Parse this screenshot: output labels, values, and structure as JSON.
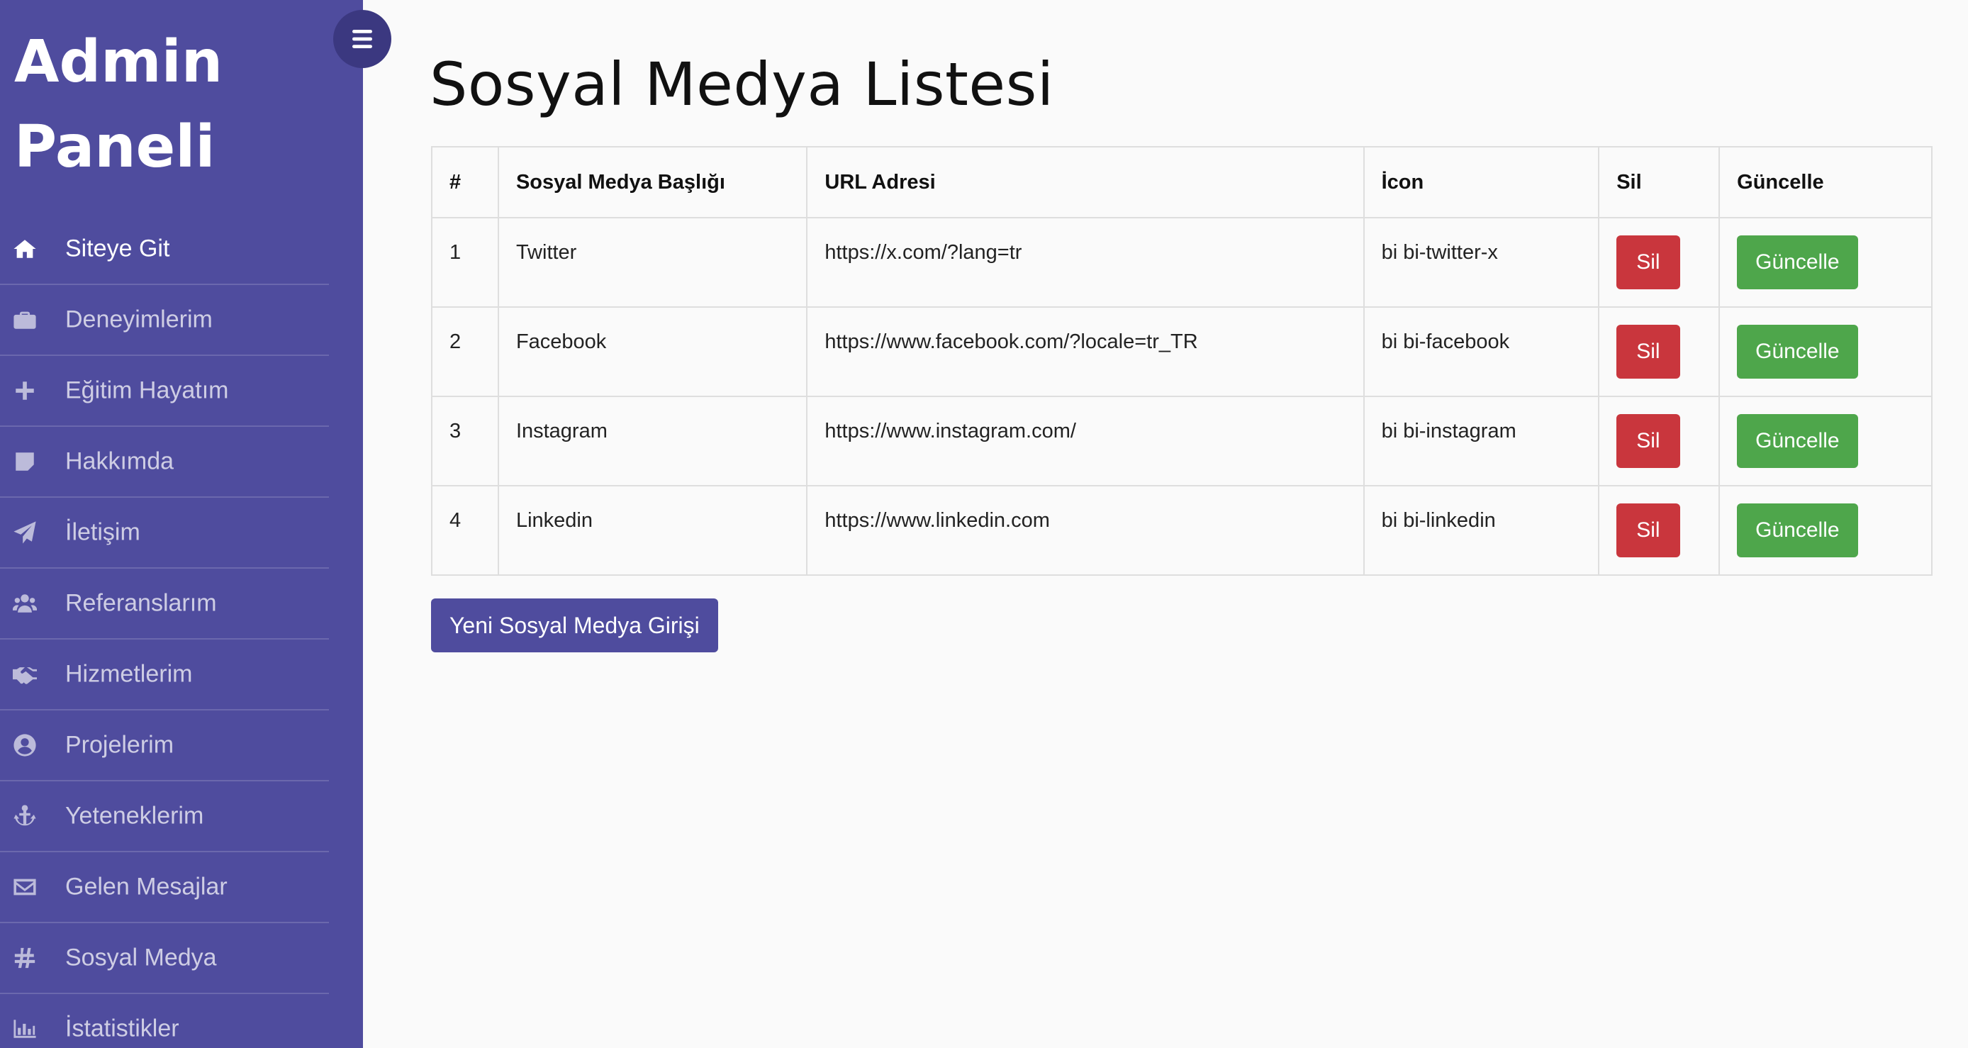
{
  "sidebar": {
    "brand": "Admin Paneli",
    "items": [
      {
        "label": "Siteye Git",
        "icon": "home-icon"
      },
      {
        "label": "Deneyimlerim",
        "icon": "briefcase-icon"
      },
      {
        "label": "Eğitim Hayatım",
        "icon": "plus-icon"
      },
      {
        "label": "Hakkımda",
        "icon": "note-icon"
      },
      {
        "label": "İletişim",
        "icon": "paper-plane-icon"
      },
      {
        "label": "Referanslarım",
        "icon": "users-icon"
      },
      {
        "label": "Hizmetlerim",
        "icon": "handshake-icon"
      },
      {
        "label": "Projelerim",
        "icon": "user-circle-icon"
      },
      {
        "label": "Yeteneklerim",
        "icon": "anchor-icon"
      },
      {
        "label": "Gelen Mesajlar",
        "icon": "envelope-icon"
      },
      {
        "label": "Sosyal Medya",
        "icon": "hashtag-icon"
      },
      {
        "label": "İstatistikler",
        "icon": "bar-chart-icon"
      }
    ]
  },
  "main": {
    "title": "Sosyal Medya Listesi",
    "table": {
      "headers": [
        "#",
        "Sosyal Medya Başlığı",
        "URL Adresi",
        "İcon",
        "Sil",
        "Güncelle"
      ],
      "rows": [
        {
          "num": "1",
          "title": "Twitter",
          "url": "https://x.com/?lang=tr",
          "icon": "bi bi-twitter-x",
          "sil": "Sil",
          "guncelle": "Güncelle"
        },
        {
          "num": "2",
          "title": "Facebook",
          "url": "https://www.facebook.com/?locale=tr_TR",
          "icon": "bi bi-facebook",
          "sil": "Sil",
          "guncelle": "Güncelle"
        },
        {
          "num": "3",
          "title": "Instagram",
          "url": "https://www.instagram.com/",
          "icon": "bi bi-instagram",
          "sil": "Sil",
          "guncelle": "Güncelle"
        },
        {
          "num": "4",
          "title": "Linkedin",
          "url": "https://www.linkedin.com",
          "icon": "bi bi-linkedin",
          "sil": "Sil",
          "guncelle": "Güncelle"
        }
      ]
    },
    "new_button": "Yeni Sosyal Medya Girişi"
  },
  "colors": {
    "sidebar_bg": "#4f4c9e",
    "toggle_bg": "#3b3880",
    "delete_btn": "#c9363d",
    "update_btn": "#4ea64b",
    "primary_btn": "#4f4c9e"
  }
}
